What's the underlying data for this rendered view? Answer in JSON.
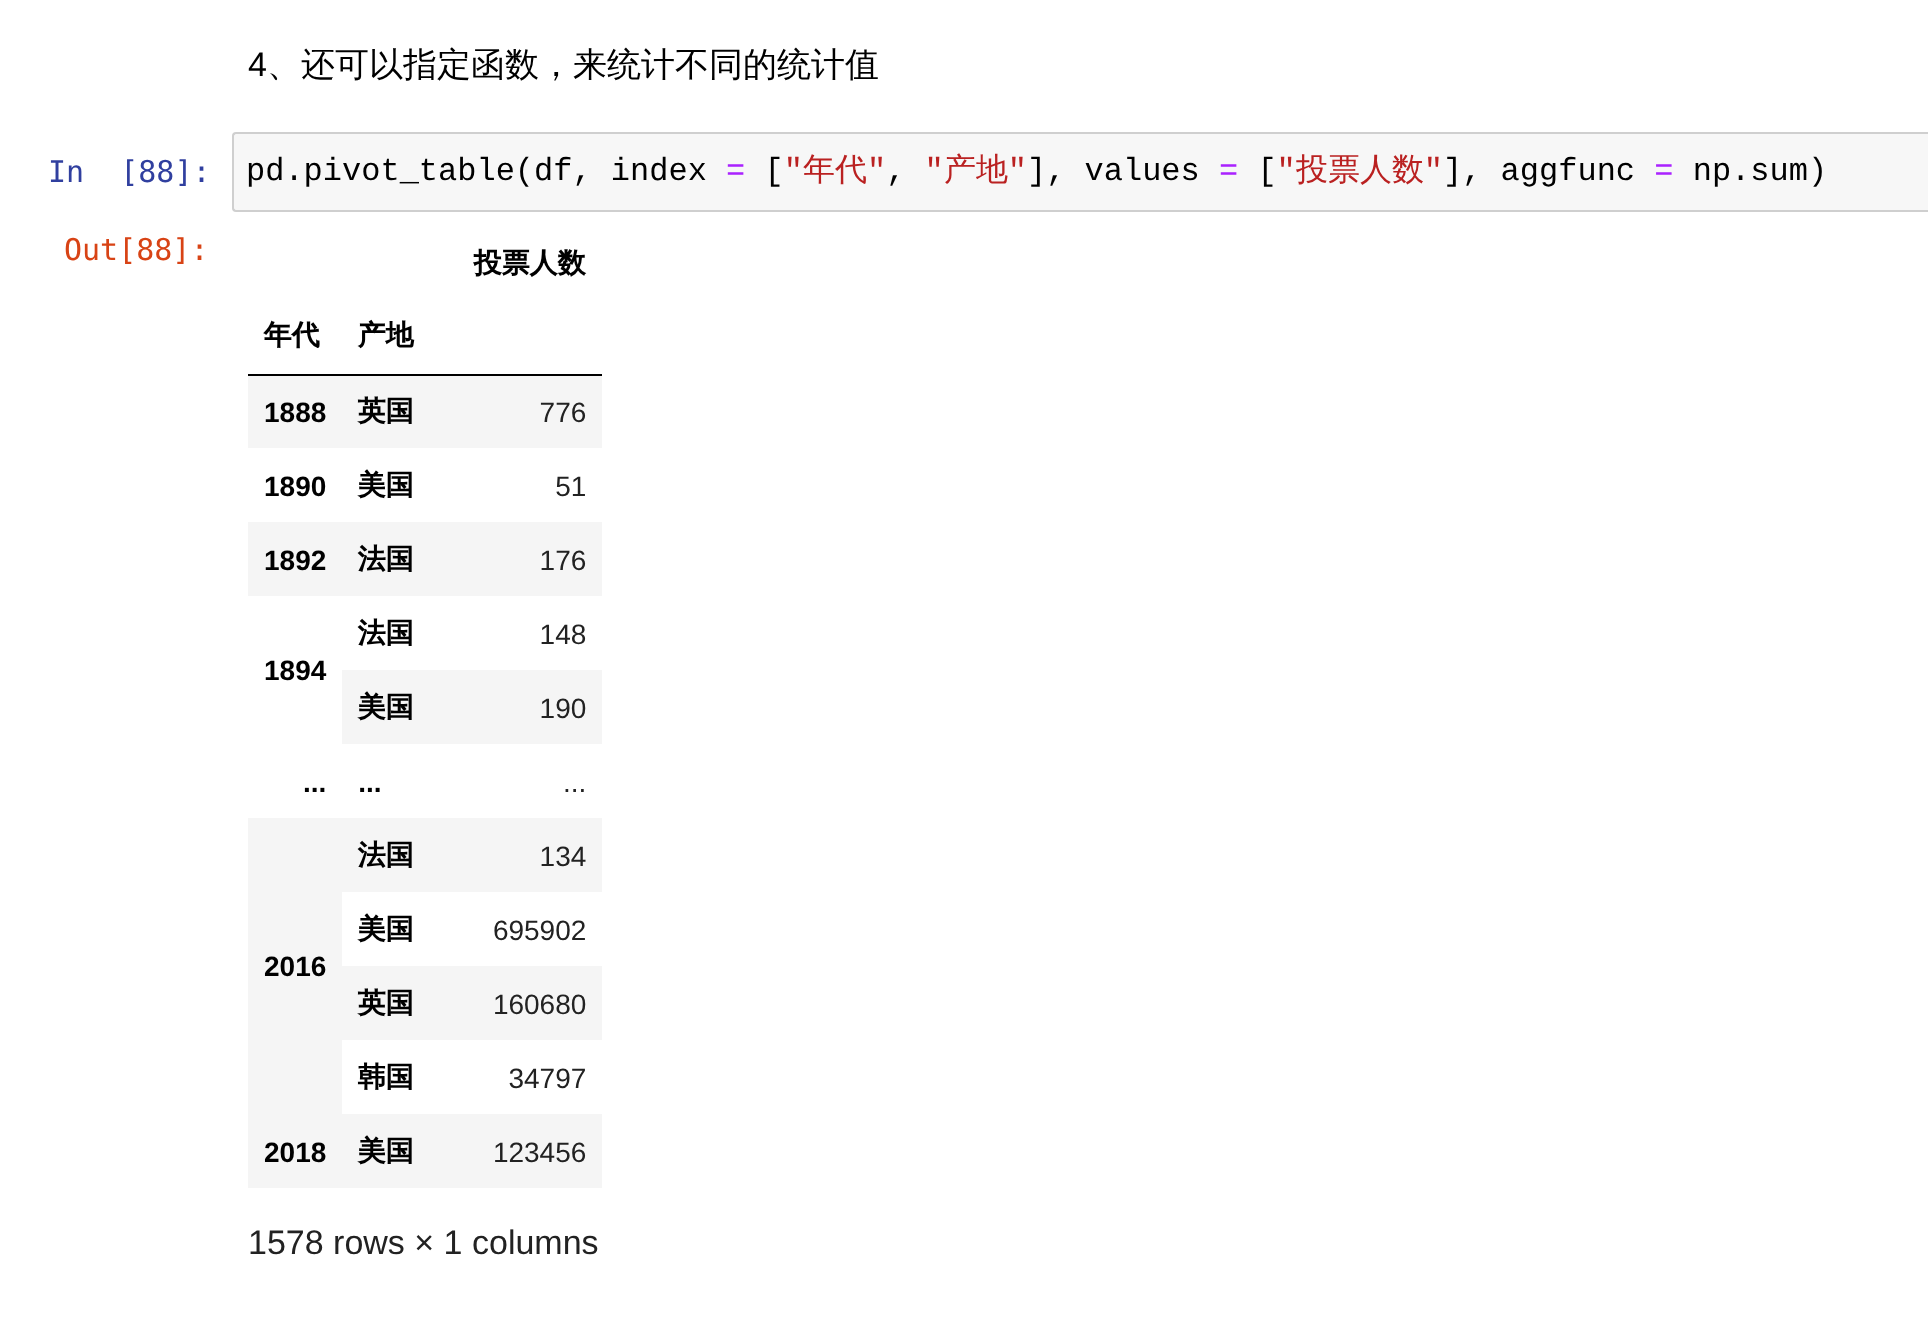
{
  "heading": "4、还可以指定函数，来统计不同的统计值",
  "cell": {
    "prompt_in": "In  [88]:",
    "code": [
      {
        "kind": "plain",
        "text": "pd.pivot_table(df, index "
      },
      {
        "kind": "operator",
        "text": "="
      },
      {
        "kind": "plain",
        "text": " ["
      },
      {
        "kind": "string",
        "text": "\"年代\""
      },
      {
        "kind": "plain",
        "text": ", "
      },
      {
        "kind": "string",
        "text": "\"产地\""
      },
      {
        "kind": "plain",
        "text": "], values "
      },
      {
        "kind": "operator",
        "text": "="
      },
      {
        "kind": "plain",
        "text": " ["
      },
      {
        "kind": "string",
        "text": "\"投票人数\""
      },
      {
        "kind": "plain",
        "text": "], aggfunc "
      },
      {
        "kind": "operator",
        "text": "="
      },
      {
        "kind": "plain",
        "text": " np.sum)"
      }
    ],
    "prompt_out": "Out[88]:",
    "table": {
      "column_header": "投票人数",
      "index_names": [
        "年代",
        "产地"
      ],
      "groups": [
        {
          "year": "1888",
          "rows": [
            {
              "origin": "英国",
              "value": "776"
            }
          ]
        },
        {
          "year": "1890",
          "rows": [
            {
              "origin": "美国",
              "value": "51"
            }
          ]
        },
        {
          "year": "1892",
          "rows": [
            {
              "origin": "法国",
              "value": "176"
            }
          ]
        },
        {
          "year": "1894",
          "rows": [
            {
              "origin": "法国",
              "value": "148"
            },
            {
              "origin": "美国",
              "value": "190"
            }
          ]
        },
        {
          "year": "...",
          "rows": [
            {
              "origin": "...",
              "value": "..."
            }
          ]
        },
        {
          "year": "2016",
          "rows": [
            {
              "origin": "法国",
              "value": "134"
            },
            {
              "origin": "美国",
              "value": "695902"
            },
            {
              "origin": "英国",
              "value": "160680"
            },
            {
              "origin": "韩国",
              "value": "34797"
            }
          ]
        },
        {
          "year": "2018",
          "rows": [
            {
              "origin": "美国",
              "value": "123456"
            }
          ]
        }
      ]
    },
    "summary": "1578 rows × 1 columns"
  }
}
